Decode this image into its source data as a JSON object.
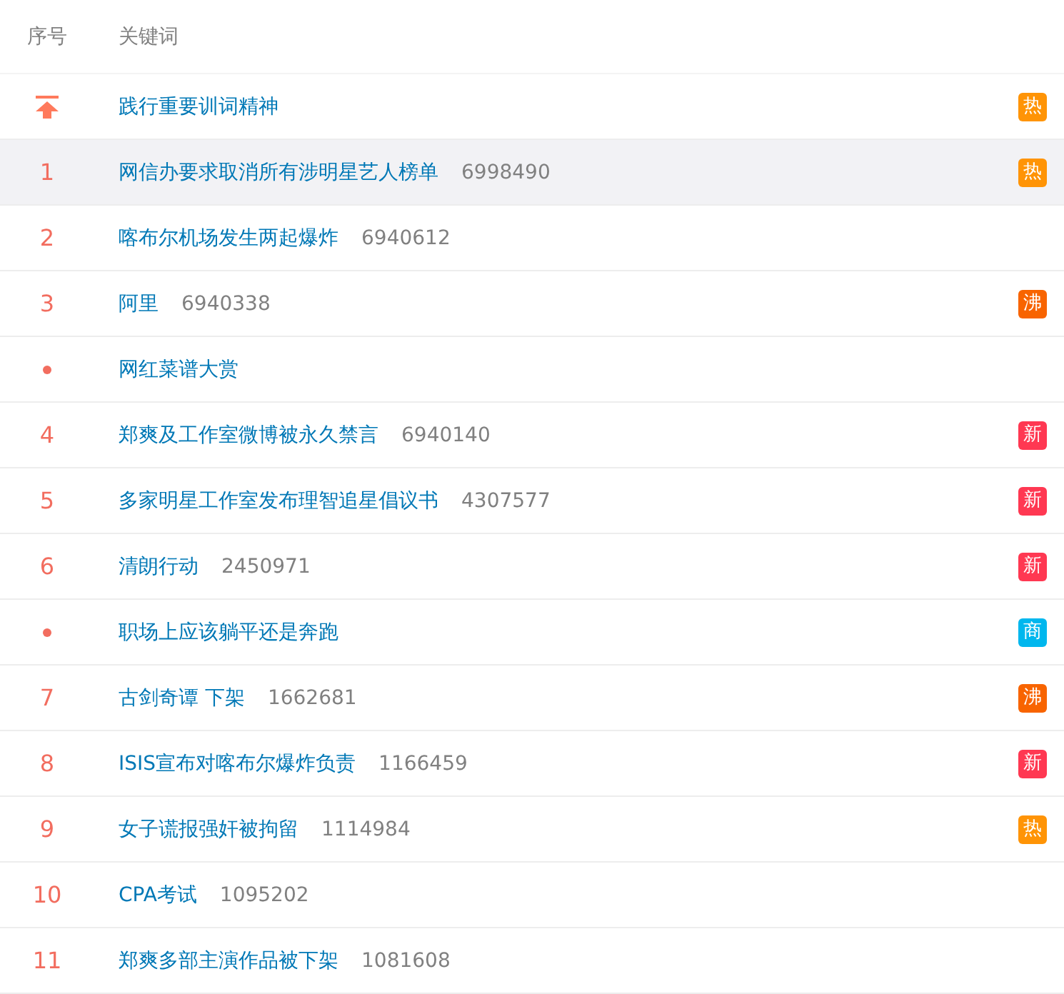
{
  "columns": [
    "序号",
    "关键词"
  ],
  "rows": [
    {
      "kind": "pinned",
      "keyword": "践行重要训词精神",
      "selected": false,
      "badge": {
        "label": "热",
        "color": "#ff9406"
      }
    },
    {
      "kind": "ranked",
      "rank": "1",
      "keyword": "网信办要求取消所有涉明星艺人榜单",
      "count": "6998490",
      "selected": true,
      "badge": {
        "label": "热",
        "color": "#ff9406"
      }
    },
    {
      "kind": "ranked",
      "rank": "2",
      "keyword": "喀布尔机场发生两起爆炸",
      "count": "6940612",
      "selected": false
    },
    {
      "kind": "ranked",
      "rank": "3",
      "keyword": "阿里",
      "count": "6940338",
      "selected": false,
      "badge": {
        "label": "沸",
        "color": "#f86400"
      }
    },
    {
      "kind": "promoted",
      "keyword": "网红菜谱大赏",
      "selected": false
    },
    {
      "kind": "ranked",
      "rank": "4",
      "keyword": "郑爽及工作室微博被永久禁言",
      "count": "6940140",
      "selected": false,
      "badge": {
        "label": "新",
        "color": "#ff3852"
      }
    },
    {
      "kind": "ranked",
      "rank": "5",
      "keyword": "多家明星工作室发布理智追星倡议书",
      "count": "4307577",
      "selected": false,
      "badge": {
        "label": "新",
        "color": "#ff3852"
      }
    },
    {
      "kind": "ranked",
      "rank": "6",
      "keyword": "清朗行动",
      "count": "2450971",
      "selected": false,
      "badge": {
        "label": "新",
        "color": "#ff3852"
      }
    },
    {
      "kind": "promoted",
      "keyword": "职场上应该躺平还是奔跑",
      "selected": false,
      "badge": {
        "label": "商",
        "color": "#00b7ee"
      }
    },
    {
      "kind": "ranked",
      "rank": "7",
      "keyword": "古剑奇谭 下架",
      "count": "1662681",
      "selected": false,
      "badge": {
        "label": "沸",
        "color": "#f86400"
      }
    },
    {
      "kind": "ranked",
      "rank": "8",
      "keyword": "ISIS宣布对喀布尔爆炸负责",
      "count": "1166459",
      "selected": false,
      "badge": {
        "label": "新",
        "color": "#ff3852"
      }
    },
    {
      "kind": "ranked",
      "rank": "9",
      "keyword": "女子谎报强奸被拘留",
      "count": "1114984",
      "selected": false,
      "badge": {
        "label": "热",
        "color": "#ff9406"
      }
    },
    {
      "kind": "ranked",
      "rank": "10",
      "keyword": "CPA考试",
      "count": "1095202",
      "selected": false
    },
    {
      "kind": "ranked",
      "rank": "11",
      "keyword": "郑爽多部主演作品被下架",
      "count": "1081608",
      "selected": false
    }
  ]
}
